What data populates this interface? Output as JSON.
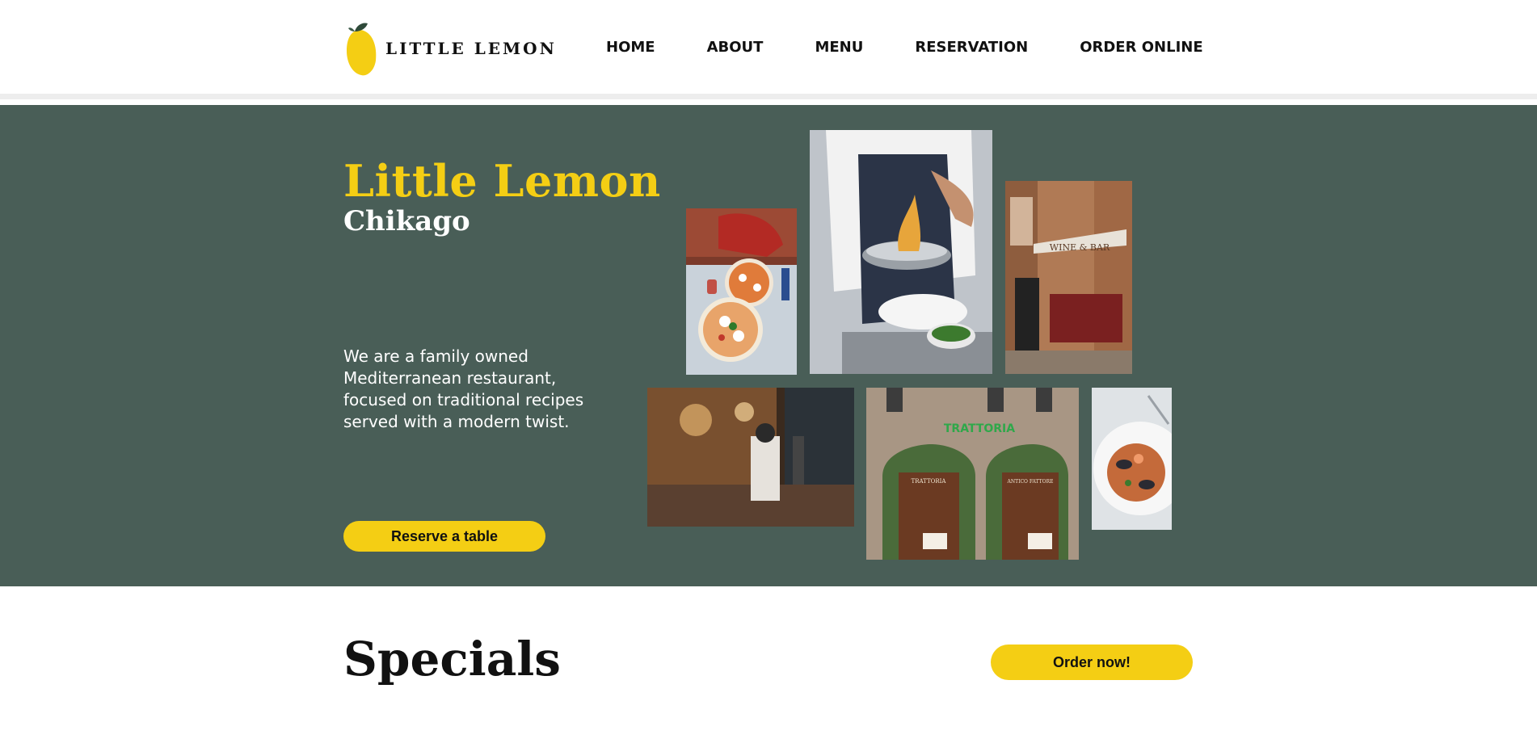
{
  "header": {
    "logo_text": "LITTLE LEMON",
    "nav": [
      "HOME",
      "ABOUT",
      "MENU",
      "RESERVATION",
      "ORDER ONLINE"
    ]
  },
  "hero": {
    "title": "Little Lemon",
    "subtitle": "Chikago",
    "description": "We are a family owned Mediterranean restaurant, focused on traditional recipes served with a modern twist.",
    "cta_label": "Reserve a table",
    "photos": {
      "pizza": "pizza-photo",
      "chef": "chef-cooking-photo",
      "wine_bar_sign": "WINE & BAR",
      "kitchen": "kitchen-photo",
      "trattoria_sign": "TRATTORIA",
      "trattoria_door_left": "TRATTORIA",
      "trattoria_door_right": "ANTICO FATTORE",
      "seafood": "seafood-dish-photo"
    }
  },
  "specials": {
    "title": "Specials",
    "order_label": "Order now!"
  },
  "colors": {
    "primary_green": "#495e57",
    "accent_yellow": "#f4ce14",
    "white": "#ffffff",
    "text_dark": "#111111"
  }
}
